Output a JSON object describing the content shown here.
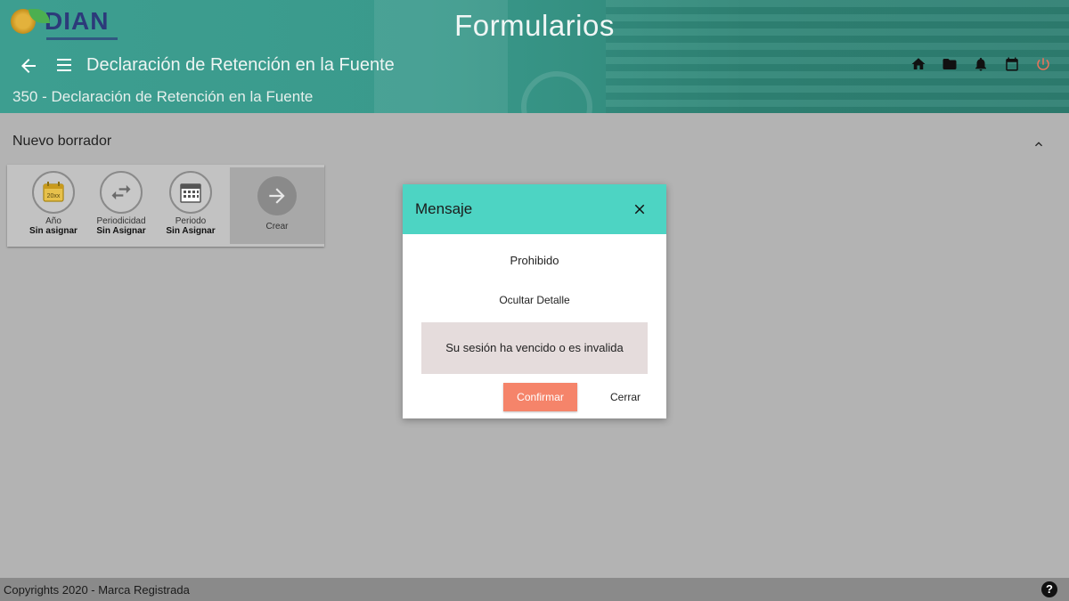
{
  "header": {
    "logo_text": "DIAN",
    "title": "Formularios",
    "subtitle": "Declaración de Retención en la Fuente",
    "form_line": "350 - Declaración de Retención en la Fuente",
    "icons": [
      "arrow-back-icon",
      "menu-icon",
      "home-icon",
      "folder-icon",
      "bell-icon",
      "calendar-icon",
      "power-icon"
    ]
  },
  "draft": {
    "section_title": "Nuevo borrador",
    "tiles": [
      {
        "label": "Año",
        "value": "Sin asignar",
        "icon": "year-calendar-icon",
        "badge": "20xx"
      },
      {
        "label": "Periodicidad",
        "value": "Sin Asignar",
        "icon": "swap-arrows-icon"
      },
      {
        "label": "Periodo",
        "value": "Sin Asignar",
        "icon": "calendar-grid-icon"
      }
    ],
    "create_label": "Crear"
  },
  "modal": {
    "title": "Mensaje",
    "status": "Prohibido",
    "toggle_detail": "Ocultar Detalle",
    "detail": "Su sesión ha vencido o es invalida",
    "confirm": "Confirmar",
    "close": "Cerrar"
  },
  "footer": {
    "text": "Copyrights 2020 - Marca Registrada",
    "help": "?"
  },
  "colors": {
    "header": "#3d9e90",
    "modal_header": "#4dd4c3",
    "confirm_button": "#f5846a",
    "power_icon": "#f0735a",
    "overlay": "#b3b3b3"
  }
}
